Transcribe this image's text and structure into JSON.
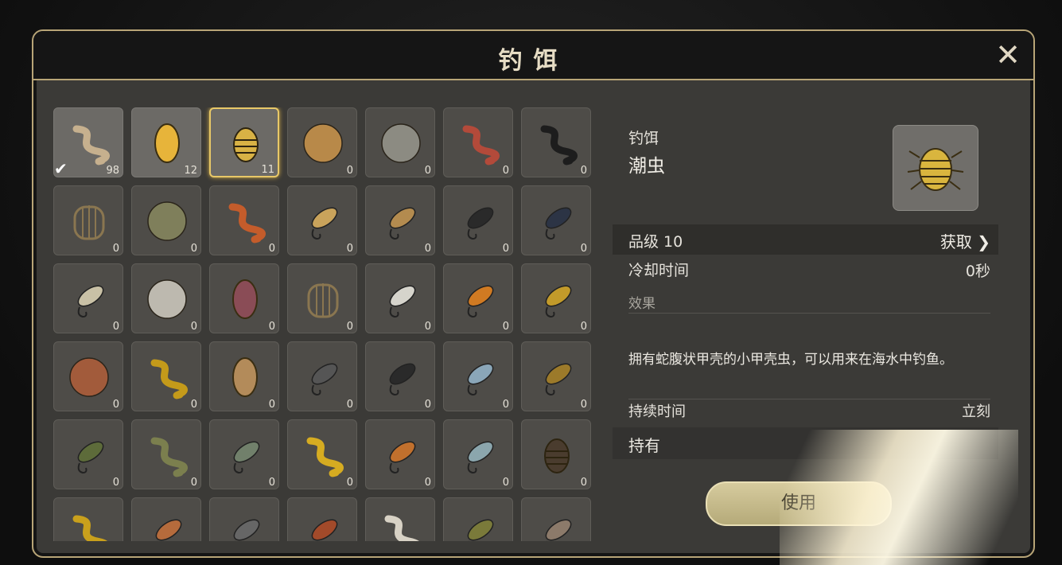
{
  "header": {
    "title": "钓饵",
    "close_icon": "close-x-icon"
  },
  "grid": {
    "rows": [
      [
        {
          "icon": "centipede-bait-icon",
          "count": "98",
          "color": "#c6b08e",
          "checked": true,
          "owned": true
        },
        {
          "icon": "larva-bait-icon",
          "count": "12",
          "color": "#e7b43a",
          "owned": true
        },
        {
          "icon": "isopod-bait-icon",
          "count": "11",
          "color": "#d8b245",
          "owned": true,
          "selected": true
        },
        {
          "icon": "dough-ball-icon",
          "count": "0",
          "color": "#b88949"
        },
        {
          "icon": "grey-ball-icon",
          "count": "0",
          "color": "#8c8b82"
        },
        {
          "icon": "red-worm-icon",
          "count": "0",
          "color": "#b34a3a"
        },
        {
          "icon": "black-coil-icon",
          "count": "0",
          "color": "#1d1d1d"
        }
      ],
      [
        {
          "icon": "cage-icon",
          "count": "0",
          "color": "#8a7650"
        },
        {
          "icon": "green-ball-icon",
          "count": "0",
          "color": "#7f7f5b"
        },
        {
          "icon": "orange-worm-icon",
          "count": "0",
          "color": "#c45c2b"
        },
        {
          "icon": "spoon-lure-icon",
          "count": "0",
          "color": "#c9a35b"
        },
        {
          "icon": "spoon-lure-icon",
          "count": "0",
          "color": "#b38b4f"
        },
        {
          "icon": "crank-lure-icon",
          "count": "0",
          "color": "#2a2a2a"
        },
        {
          "icon": "fly-lure-icon",
          "count": "0",
          "color": "#2c3445"
        }
      ],
      [
        {
          "icon": "white-spoon-icon",
          "count": "0",
          "color": "#c9c1a6"
        },
        {
          "icon": "white-ball-icon",
          "count": "0",
          "color": "#bdb9af"
        },
        {
          "icon": "grub-icon",
          "count": "0",
          "color": "#8a4c56"
        },
        {
          "icon": "cage-icon",
          "count": "0",
          "color": "#8a7650"
        },
        {
          "icon": "spoon-lure-icon",
          "count": "0",
          "color": "#d6d4cc"
        },
        {
          "icon": "orange-spoon-icon",
          "count": "0",
          "color": "#d07a22"
        },
        {
          "icon": "feather-fly-icon",
          "count": "0",
          "color": "#c29a2a"
        }
      ],
      [
        {
          "icon": "brown-ball-icon",
          "count": "0",
          "color": "#a25b3b"
        },
        {
          "icon": "yellow-worm-icon",
          "count": "0",
          "color": "#c49a1a"
        },
        {
          "icon": "grub-icon",
          "count": "0",
          "color": "#b38b5a"
        },
        {
          "icon": "spinner-lure-icon",
          "count": "0",
          "color": "#555"
        },
        {
          "icon": "crank-lure-icon",
          "count": "0",
          "color": "#2a2a2a"
        },
        {
          "icon": "blue-spoon-icon",
          "count": "0",
          "color": "#8aa6b8"
        },
        {
          "icon": "dragonfly-lure-icon",
          "count": "0",
          "color": "#9c7a2a"
        }
      ],
      [
        {
          "icon": "frog-lure-icon",
          "count": "0",
          "color": "#5d6b3a"
        },
        {
          "icon": "green-worm-icon",
          "count": "0",
          "color": "#7b7f4e"
        },
        {
          "icon": "lizard-lure-icon",
          "count": "0",
          "color": "#71806b"
        },
        {
          "icon": "yellow-worm-icon",
          "count": "0",
          "color": "#d6ac21"
        },
        {
          "icon": "orange-spoon-icon",
          "count": "0",
          "color": "#c1702d"
        },
        {
          "icon": "blue-spoon-icon",
          "count": "0",
          "color": "#8ba6ad"
        },
        {
          "icon": "beetle-icon",
          "count": "0",
          "color": "#4a3c2e"
        }
      ],
      [
        {
          "icon": "yellow-worm-icon",
          "count": "",
          "color": "#c9a01c"
        },
        {
          "icon": "shrimp-icon",
          "count": "",
          "color": "#b56b3c"
        },
        {
          "icon": "squid-icon",
          "count": "",
          "color": "#666"
        },
        {
          "icon": "dragonfly-lure-icon",
          "count": "",
          "color": "#a24a2a"
        },
        {
          "icon": "white-worm-icon",
          "count": "",
          "color": "#d8d2c5"
        },
        {
          "icon": "crawfish-icon",
          "count": "",
          "color": "#7a7a3a"
        },
        {
          "icon": "shrimp-icon",
          "count": "",
          "color": "#8c7a6a"
        }
      ]
    ]
  },
  "detail": {
    "category": "钓饵",
    "name": "潮虫",
    "thumb_icon": "isopod-bait-icon",
    "grade_label": "品级 10",
    "get_label": "获取",
    "cooldown_label": "冷却时间",
    "cooldown_value": "0秒",
    "effect_label": "效果",
    "description": "拥有蛇腹状甲壳的小甲壳虫，可以用来在海水中钓鱼。",
    "duration_label": "持续时间",
    "duration_value": "立刻",
    "own_label": "持有",
    "use_label": "使用"
  }
}
